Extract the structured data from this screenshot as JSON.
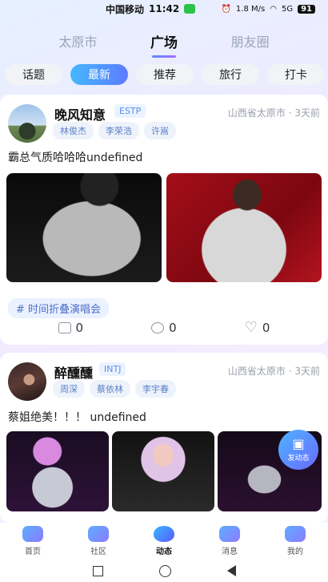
{
  "status_bar": {
    "carrier": "中国移动",
    "time": "11:42",
    "net_speed": "1.8 M/s",
    "signal": "5G",
    "battery": "91"
  },
  "top_tabs": [
    {
      "label": "太原市"
    },
    {
      "label": "广场"
    },
    {
      "label": "朋友圈"
    }
  ],
  "sub_categories": [
    {
      "label": "话题"
    },
    {
      "label": "最新"
    },
    {
      "label": "推荐"
    },
    {
      "label": "旅行"
    },
    {
      "label": "打卡"
    }
  ],
  "posts": [
    {
      "author": "晚风知意",
      "mbti": "ESTP",
      "location_time": "山西省太原市 · 3天前",
      "tags": [
        "林俊杰",
        "李荣浩",
        "许嵩"
      ],
      "text": "霸总气质哈哈哈undefined",
      "topic": "# 时间折叠演唱会",
      "shares": "0",
      "comments": "0",
      "likes": "0"
    },
    {
      "author": "醉醺醺",
      "mbti": "INTJ",
      "location_time": "山西省太原市 · 3天前",
      "tags": [
        "周深",
        "蔡依林",
        "李宇春"
      ],
      "text": "蔡姐绝美！！！ undefined"
    }
  ],
  "fab": {
    "label": "发动态"
  },
  "bottom_nav": [
    {
      "label": "首页"
    },
    {
      "label": "社区"
    },
    {
      "label": "动态"
    },
    {
      "label": "消息"
    },
    {
      "label": "我的"
    }
  ]
}
